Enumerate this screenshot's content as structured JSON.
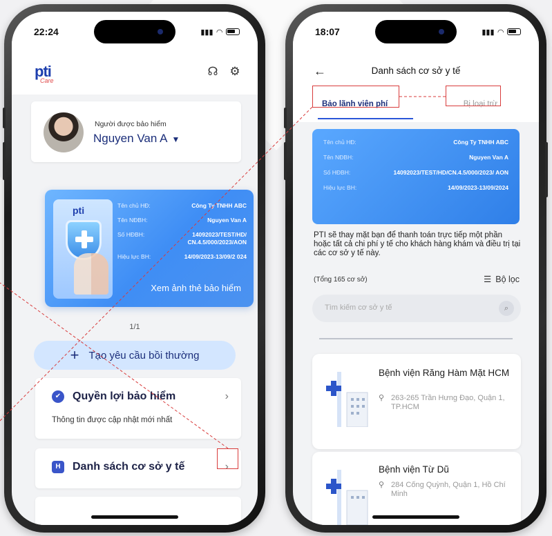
{
  "left_phone": {
    "status_time": "22:24",
    "logo": {
      "brand": "pti",
      "sub": "Care"
    },
    "header_icons": [
      "headset-icon",
      "settings-icon"
    ],
    "user": {
      "label": "Người được bảo hiểm",
      "name": "Nguyen Van A"
    },
    "card": {
      "rows": [
        {
          "k": "Tên chủ HĐ:",
          "v": "Công Ty TNHH ABC"
        },
        {
          "k": "Tên NĐBH:",
          "v": "Nguyen Van A"
        },
        {
          "k": "Số HĐBH:",
          "v": "14092023/TEST/HD/ CN.4.5/000/2023/AON"
        },
        {
          "k": "Hiệu lực BH:",
          "v": "14/09/2023-13/09/2 024"
        }
      ],
      "link": "Xem ảnh thẻ bảo hiểm"
    },
    "pager": "1/1",
    "claim_button": "Tạo yêu cầu bồi thường",
    "benefits": {
      "title": "Quyền lợi bảo hiểm",
      "subtitle": "Thông tin được cập nhật mới nhất"
    },
    "facilities": {
      "title": "Danh sách cơ sở y tế"
    }
  },
  "right_phone": {
    "status_time": "18:07",
    "title": "Danh sách cơ sở y tế",
    "tabs": {
      "active": "Bảo lãnh viện phí",
      "inactive": "Bị loại trừ"
    },
    "card": {
      "rows": [
        {
          "k": "Tên chủ HĐ:",
          "v": "Công Ty TNHH ABC"
        },
        {
          "k": "Tên NĐBH:",
          "v": "Nguyen Van A"
        },
        {
          "k": "Số HĐBH:",
          "v": "14092023/TEST/HD/CN.4.5/000/2023/ AON"
        },
        {
          "k": "Hiệu lực BH:",
          "v": "14/09/2023-13/09/2024"
        }
      ]
    },
    "description": "PTI sẽ thay mặt bạn để thanh toán trực tiếp một phần hoặc tất cả chi phí y tế cho khách hàng khám và điều trị tại các cơ sở y tế này.",
    "total": "(Tổng 165 cơ sở)",
    "filter_label": "Bộ lọc",
    "search_placeholder": "Tìm kiếm cơ sở y tế",
    "hospitals": [
      {
        "name": "Bệnh viện Răng Hàm Mặt HCM",
        "address": "263-265 Trần Hưng Đạo, Quận 1, TP.HCM"
      },
      {
        "name": "Bệnh viện Từ Dũ",
        "address": "284 Cống Quỳnh, Quận 1, Hồ Chí Minh"
      }
    ]
  },
  "colors": {
    "brand_blue": "#1b2e7a",
    "card_blue": "#3f8ef5",
    "highlight_red": "#d83b3b"
  }
}
